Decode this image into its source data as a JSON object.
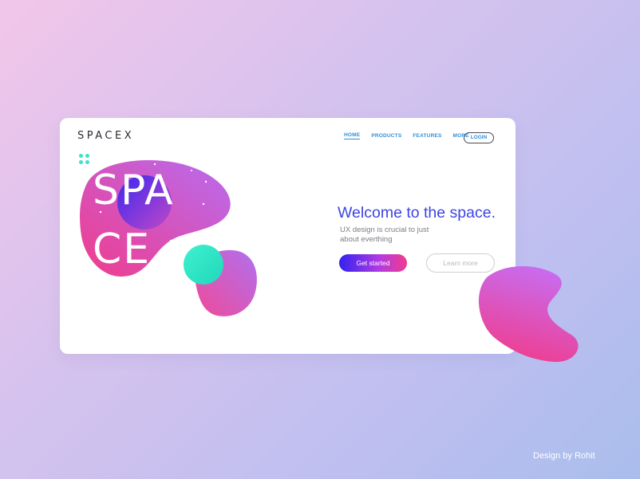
{
  "brand": {
    "logo": "SPACEX"
  },
  "nav": {
    "items": [
      {
        "label": "HOME",
        "active": true
      },
      {
        "label": "PRODUCTS"
      },
      {
        "label": "FEATURES"
      },
      {
        "label": "MORE"
      }
    ],
    "login_label": "LOGIN"
  },
  "hero": {
    "art_line1": "SPA",
    "art_line2": "CE",
    "headline": "Welcome to the space.",
    "subtext": "UX design is crucial to just about everthing",
    "primary_button": "Get started",
    "secondary_button": "Learn more"
  },
  "footer": {
    "credit": "Design by Rohit"
  },
  "colors": {
    "accent_blue": "#3d45e3",
    "nav_blue": "#2f8fd8",
    "teal": "#3fe0c8",
    "pink": "#f03c8c",
    "purple": "#b36cf0"
  },
  "icons": [
    "grid-dots-icon"
  ]
}
